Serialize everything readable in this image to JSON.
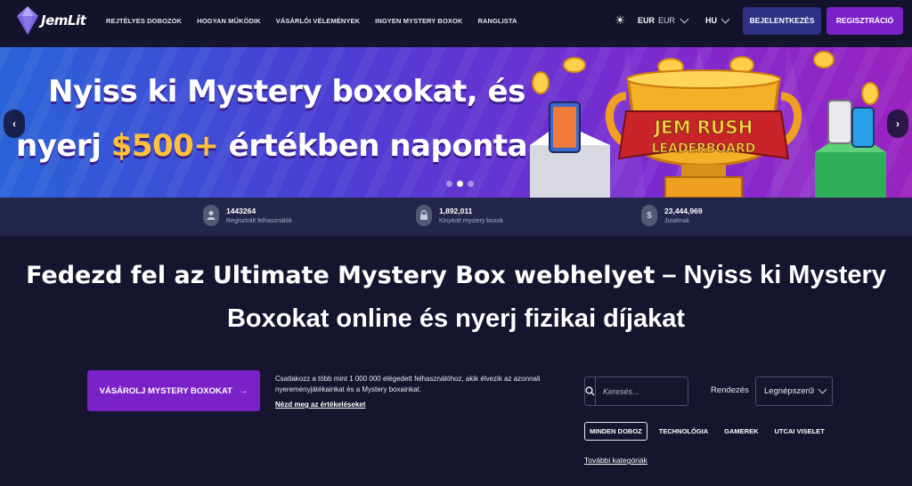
{
  "nav": {
    "logo_text": "JemLit",
    "links": [
      "REJTÉLYES DOBOZOK",
      "HOGYAN MŰKÖDIK",
      "VÁSÁRLÓI VÉLEMÉNYEK",
      "INGYEN MYSTERY BOXOK",
      "RANGLISTA"
    ],
    "theme_icon": "sun-icon",
    "currency": "EUR",
    "currency_sub": "EUR",
    "language": "HU",
    "login_label": "BEJELENTKEZÉS",
    "register_label": "REGISZTRÁCIÓ"
  },
  "banner": {
    "line1": "Nyiss ki Mystery boxokat, és",
    "line2_pre": "nyerj ",
    "line2_amount": "$500+",
    "line2_post": " értékben naponta",
    "art_line1": "JEM RUSH",
    "art_line2": "LEADERBOARD",
    "prev": "‹",
    "next": "›",
    "slide_count": 3,
    "active_slide": 2
  },
  "stats": [
    {
      "value": "1443264",
      "label": "Regisztrált felhasználók",
      "icon": "user-icon"
    },
    {
      "value": "1,892,011",
      "label": "Kinyitott mystery boxok",
      "icon": "lock-icon"
    },
    {
      "value": "23,444,969",
      "label": "Jutalmak",
      "icon": "dollar-icon"
    }
  ],
  "headline": {
    "strong": "Fedezd fel az Ultimate Mystery Box webhelyet",
    "rest": " – Nyiss ki Mystery Boxokat online és nyerj fizikai díjakat"
  },
  "cta": {
    "button_label": "VÁSÁROLJ MYSTERY BOXOKAT",
    "arrow": "→",
    "text": "Csatlakozz a több mint 1 000 000 elégedett felhasználóhoz, akik élvezik az azonnali nyereményjátékainkat és a Mystery boxainkat.",
    "link": "Nézd meg az értékeléseket"
  },
  "search": {
    "placeholder": "Keresés..."
  },
  "sort": {
    "label": "Rendezés",
    "value": "Legnépszerűbb"
  },
  "categories": {
    "items": [
      "MINDEN DOBOZ",
      "TECHNOLÓGIA",
      "GAMEREK",
      "UTCAI VISELET"
    ],
    "more": "További kategóriák"
  },
  "colors": {
    "background": "#15152f",
    "accent_purple": "#7a22c8",
    "login_blue": "#2d3284",
    "banner_amount": "#ffc13a"
  }
}
